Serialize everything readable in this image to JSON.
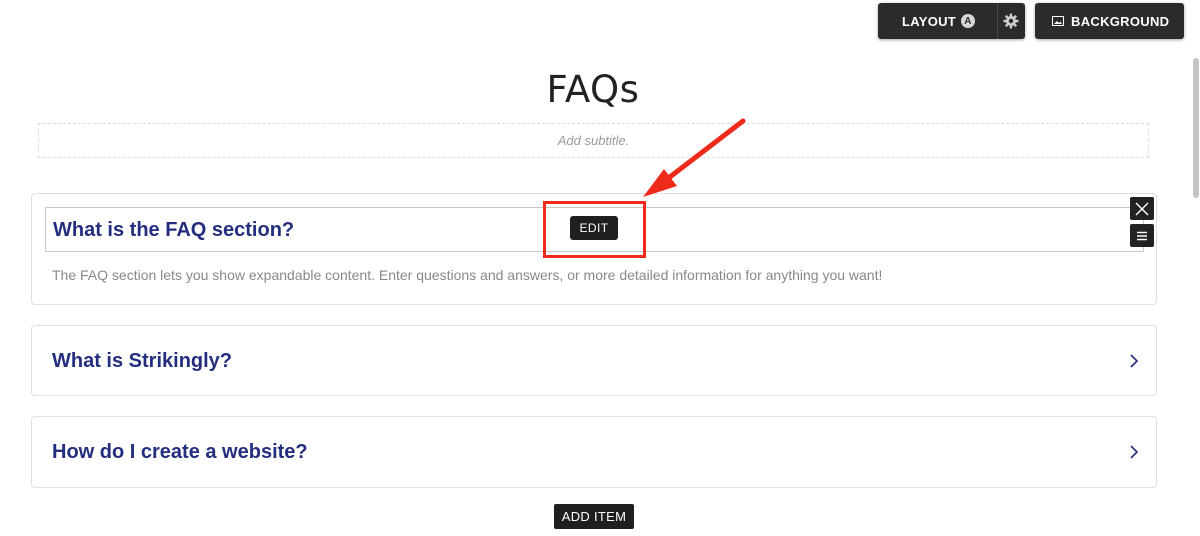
{
  "toolbar": {
    "layout_label": "LAYOUT",
    "layout_badge": "A",
    "background_label": "BACKGROUND"
  },
  "section": {
    "title": "FAQs",
    "subtitle_placeholder": "Add subtitle."
  },
  "faq_items": [
    {
      "question": "What is the FAQ section?",
      "answer": "The FAQ section lets you show expandable content. Enter questions and answers, or more detailed information for anything you want!",
      "expanded": true
    },
    {
      "question": "What is Strikingly?",
      "expanded": false
    },
    {
      "question": "How do I create a website?",
      "expanded": false
    }
  ],
  "edit_label": "EDIT",
  "add_item_label": "ADD ITEM",
  "colors": {
    "question_text": "#232e7f",
    "annotation_red": "#ee2a1b",
    "toolbar_bg": "#2b2b2b"
  }
}
